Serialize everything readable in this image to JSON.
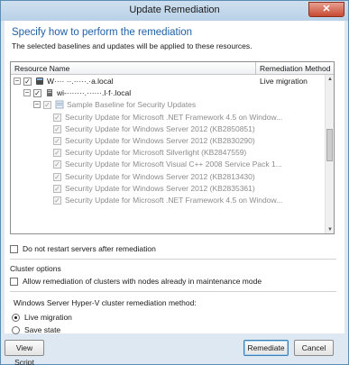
{
  "window": {
    "title": "Update Remediation",
    "close_glyph": "✕"
  },
  "header": {
    "heading": "Specify how to perform the remediation",
    "subtext": "The selected baselines and updates will be applied to these resources."
  },
  "tree": {
    "columns": [
      "Resource Name",
      "Remediation Method"
    ],
    "rows": [
      {
        "level": 0,
        "expander": "⊟",
        "checked": true,
        "icon": "cluster-icon",
        "label": "W···· ··.·····.·a.local",
        "method": "Live migration",
        "disabled": false
      },
      {
        "level": 1,
        "expander": "⊟",
        "checked": true,
        "icon": "server-icon",
        "label": "wi-·······.······.l·f·.local",
        "method": "",
        "disabled": false
      },
      {
        "level": 2,
        "expander": "⊟",
        "checked": true,
        "icon": "baseline-icon",
        "label": "Sample Baseline for Security Updates",
        "method": "",
        "disabled": true
      },
      {
        "level": 3,
        "checked": true,
        "label": "Security Update for Microsoft .NET Framework 4.5 on Window...",
        "disabled": true
      },
      {
        "level": 3,
        "checked": true,
        "label": "Security Update for Windows Server 2012 (KB2850851)",
        "disabled": true
      },
      {
        "level": 3,
        "checked": true,
        "label": "Security Update for Windows Server 2012 (KB2830290)",
        "disabled": true
      },
      {
        "level": 3,
        "checked": true,
        "label": "Security Update for Microsoft Silverlight (KB2847559)",
        "disabled": true
      },
      {
        "level": 3,
        "checked": true,
        "label": "Security Update for Microsoft Visual C++ 2008 Service Pack 1...",
        "disabled": true
      },
      {
        "level": 3,
        "checked": true,
        "label": "Security Update for Windows Server 2012 (KB2813430)",
        "disabled": true
      },
      {
        "level": 3,
        "checked": true,
        "label": "Security Update for Windows Server 2012 (KB2835361)",
        "disabled": true
      },
      {
        "level": 3,
        "checked": true,
        "label": "Security Update for Microsoft .NET Framework 4.5 on Window...",
        "disabled": true
      }
    ]
  },
  "options": {
    "no_restart_label": "Do not restart servers after remediation",
    "no_restart_checked": false,
    "cluster_options_label": "Cluster options",
    "allow_maintenance_label": "Allow remediation of clusters with nodes already in maintenance mode",
    "allow_maintenance_checked": false,
    "hyperv_method_label": "Windows Server Hyper-V cluster remediation method:",
    "radio_live": "Live migration",
    "radio_save": "Save state",
    "selected_method": "live"
  },
  "footer": {
    "view_script": "View Script",
    "remediate": "Remediate",
    "cancel": "Cancel"
  },
  "colors": {
    "heading_blue": "#1e5fa8",
    "window_frame": "#dde8f2"
  }
}
